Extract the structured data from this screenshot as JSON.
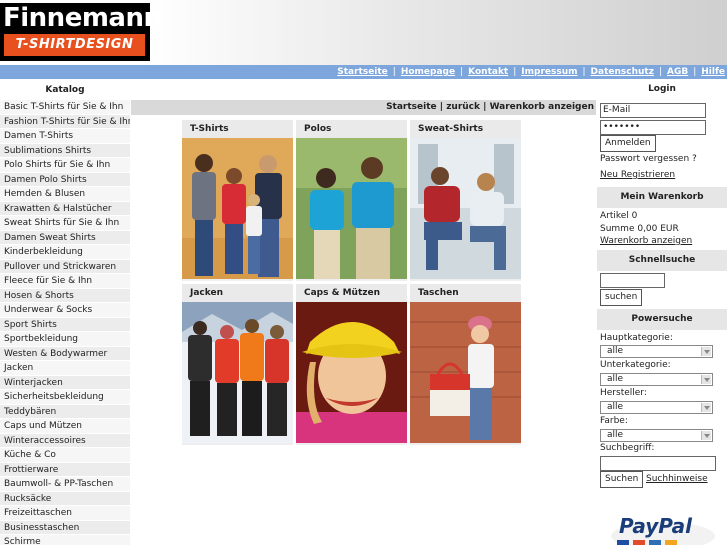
{
  "logo": {
    "line1": "Finnemann",
    "line2": "T-SHIRTDESIGN"
  },
  "topnav": [
    "Startseite",
    "Homepage",
    "Kontakt",
    "Impressum",
    "Datenschutz",
    "AGB",
    "Hilfe"
  ],
  "catalog": {
    "title": "Katalog",
    "items": [
      "Basic T-Shirts für Sie & Ihn",
      "Fashion T-Shirts für Sie & Ihn",
      "Damen T-Shirts",
      "Sublimations Shirts",
      "Polo Shirts für Sie & Ihn",
      "Damen Polo Shirts",
      "Hemden & Blusen",
      "Krawatten & Halstücher",
      "Sweat Shirts für Sie & Ihn",
      "Damen Sweat Shirts",
      "Kinderbekleidung",
      "Pullover und Strickwaren",
      "Fleece für Sie & Ihn",
      "Hosen & Shorts",
      "Underwear & Socks",
      "Sport Shirts",
      "Sportbekleidung",
      "Westen & Bodywarmer",
      "Jacken",
      "Winterjacken",
      "Sicherheitsbekleidung",
      "Teddybären",
      "Caps und Mützen",
      "Winteraccessoires",
      "Küche & Co",
      "Frottierware",
      "Baumwoll- & PP-Taschen",
      "Rucksäcke",
      "Freizeittaschen",
      "Businesstaschen",
      "Schirme"
    ]
  },
  "breadcrumb": {
    "home": "Startseite",
    "back": "zurück",
    "cart": "Warenkorb anzeigen"
  },
  "tiles": [
    {
      "label": "T-Shirts"
    },
    {
      "label": "Polos"
    },
    {
      "label": "Sweat-Shirts"
    },
    {
      "label": "Jacken"
    },
    {
      "label": "Caps & Mützen"
    },
    {
      "label": "Taschen"
    }
  ],
  "login": {
    "title": "Login",
    "email_value": "E-Mail",
    "password_value": "•••••••",
    "submit": "Anmelden",
    "forgot": "Passwort vergessen ?",
    "register": "Neu Registrieren"
  },
  "cart": {
    "title": "Mein Warenkorb",
    "items": "Artikel 0",
    "sum": "Summe 0,00 EUR",
    "show": "Warenkorb anzeigen"
  },
  "quicksearch": {
    "title": "Schnellsuche",
    "button": "suchen"
  },
  "powersearch": {
    "title": "Powersuche",
    "main_label": "Hauptkategorie:",
    "main_value": "alle",
    "sub_label": "Unterkategorie:",
    "sub_value": "alle",
    "maker_label": "Hersteller:",
    "maker_value": "alle",
    "color_label": "Farbe:",
    "color_value": "alle",
    "term_label": "Suchbegriff:",
    "button": "Suchen",
    "hints": "Suchhinweise"
  },
  "paypal": {
    "logo": "PayPal"
  },
  "colors": {
    "topbar": "#7da6dc",
    "logo_orange": "#e8501e"
  }
}
